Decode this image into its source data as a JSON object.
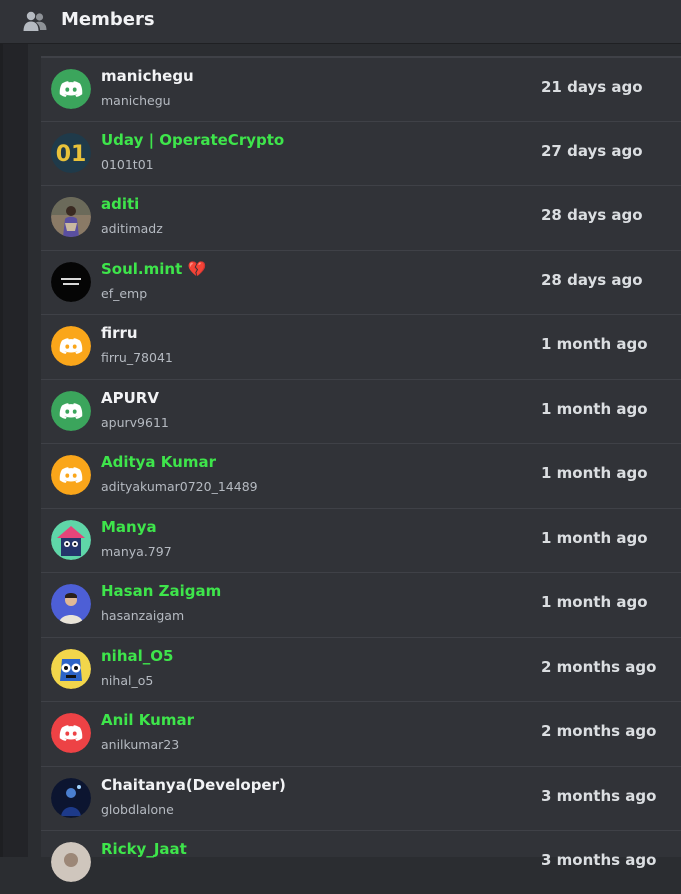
{
  "header": {
    "title": "Members",
    "icon": "members-icon"
  },
  "colors": {
    "green_role": "#3ee54b",
    "white_name": "#f2f3f5",
    "discord_green": "#3ba55c",
    "discord_orange": "#faa61a",
    "discord_red": "#ed4245"
  },
  "members": [
    {
      "display_name": "manichegu",
      "username": "manichegu",
      "joined": "21 days ago",
      "name_color": "#f2f3f5",
      "avatar": "discord-green"
    },
    {
      "display_name": "Uday | OperateCrypto",
      "username": "0101t01",
      "joined": "27 days ago",
      "name_color": "#3ee54b",
      "avatar": "01-logo"
    },
    {
      "display_name": "aditi",
      "username": "aditimadz",
      "joined": "28 days ago",
      "name_color": "#3ee54b",
      "avatar": "photo"
    },
    {
      "display_name": "Soul.mint 💔",
      "username": "ef_emp",
      "joined": "28 days ago",
      "name_color": "#3ee54b",
      "avatar": "dark-text"
    },
    {
      "display_name": "firru",
      "username": "firru_78041",
      "joined": "1 month ago",
      "name_color": "#f2f3f5",
      "avatar": "discord-orange"
    },
    {
      "display_name": "APURV",
      "username": "apurv9611",
      "joined": "1 month ago",
      "name_color": "#f2f3f5",
      "avatar": "discord-green"
    },
    {
      "display_name": "Aditya Kumar",
      "username": "adityakumar0720_14489",
      "joined": "1 month ago",
      "name_color": "#3ee54b",
      "avatar": "discord-orange"
    },
    {
      "display_name": "Manya",
      "username": "manya.797",
      "joined": "1 month ago",
      "name_color": "#3ee54b",
      "avatar": "illustration"
    },
    {
      "display_name": "Hasan Zaigam",
      "username": "hasanzaigam",
      "joined": "1 month ago",
      "name_color": "#3ee54b",
      "avatar": "portrait-blue"
    },
    {
      "display_name": "nihal_O5",
      "username": "nihal_o5",
      "joined": "2 months ago",
      "name_color": "#3ee54b",
      "avatar": "cartoon-yellow"
    },
    {
      "display_name": "Anil Kumar",
      "username": "anilkumar23",
      "joined": "2 months ago",
      "name_color": "#3ee54b",
      "avatar": "discord-red"
    },
    {
      "display_name": "Chaitanya(Developer)",
      "username": "globdlalone",
      "joined": "3 months ago",
      "name_color": "#f2f3f5",
      "avatar": "dark-art"
    },
    {
      "display_name": "Ricky_Jaat",
      "username": "",
      "joined": "3 months ago",
      "name_color": "#3ee54b",
      "avatar": "photo-light"
    }
  ]
}
